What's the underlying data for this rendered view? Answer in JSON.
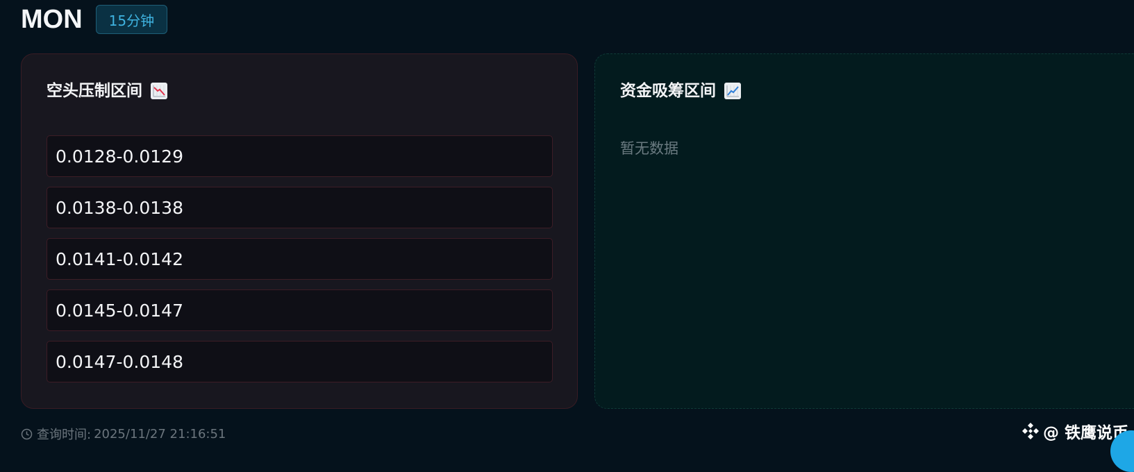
{
  "header": {
    "symbol": "MON",
    "timeframe": "15分钟"
  },
  "short_panel": {
    "title": "空头压制区间",
    "icon": "chart-decreasing-icon",
    "ranges": [
      "0.0128-0.0129",
      "0.0138-0.0138",
      "0.0141-0.0142",
      "0.0145-0.0147",
      "0.0147-0.0148"
    ]
  },
  "accumulation_panel": {
    "title": "资金吸筹区间",
    "icon": "chart-increasing-icon",
    "empty_text": "暂无数据"
  },
  "footer": {
    "query_label": "查询时间:",
    "query_time": "2025/11/27 21:16:51",
    "watermark": "@ 铁鹰说币"
  },
  "colors": {
    "background": "#05121c",
    "badge_text": "#3fb3e0",
    "short_border": "#3d1d26",
    "long_panel_bg": "#031b1e"
  }
}
